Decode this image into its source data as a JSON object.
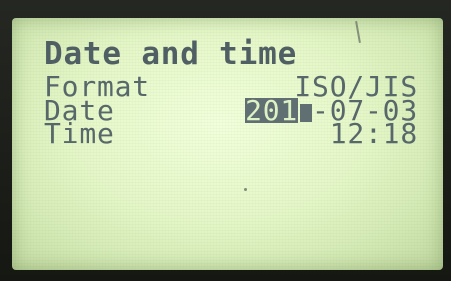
{
  "screen": {
    "title": "Date and time",
    "rows": [
      {
        "label": "Format",
        "value": "ISO/JIS"
      },
      {
        "label": "Date",
        "year": "201",
        "value": "-07-03"
      },
      {
        "label": "Time",
        "value": "12:18"
      }
    ]
  },
  "colors": {
    "lcd_background": "#e5f7c8",
    "lcd_text": "#57676a",
    "selection": "#5f6f72",
    "device_frame": "#1c1f1a"
  }
}
